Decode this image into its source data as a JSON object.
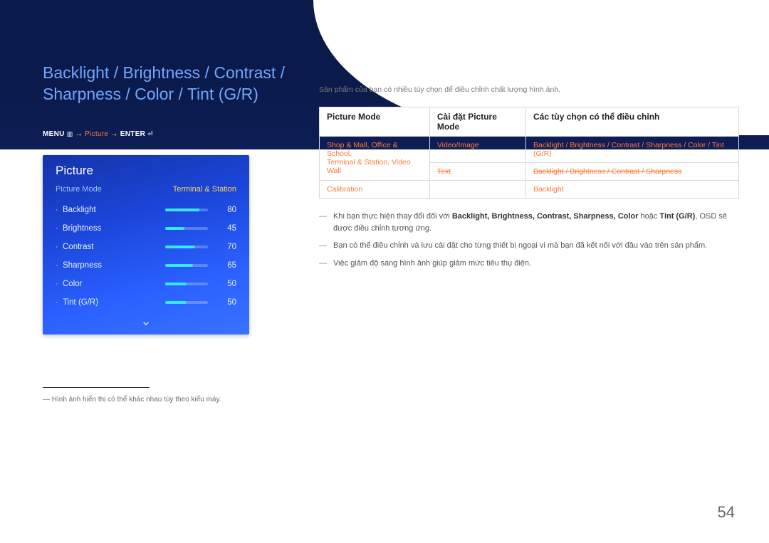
{
  "title": "Backlight / Brightness / Contrast / Sharpness / Color / Tint (G/R)",
  "menu_path": {
    "prefix": "MENU",
    "icon1": "▥",
    "arrow": "→",
    "mid": "Picture",
    "suffix": "ENTER",
    "icon2": "⏎"
  },
  "intro": "Sản phẩm của bạn có nhiều tùy chọn để điều chỉnh chất lượng hình ảnh.",
  "table": {
    "headers": [
      "Picture Mode",
      "Cài đặt Picture Mode",
      "Các tùy chọn có thể điều chỉnh"
    ],
    "rows": [
      {
        "c1_line1a": "Shop & Mall",
        "c1_line1b": "Office & School",
        "c1_line2a": "Terminal & Station",
        "c1_line2b": "Video Wall",
        "c2_r1": "Video/Image",
        "c2_r2": "Text",
        "c3_r1": "Backlight / Brightness / Contrast / Sharpness / Color / Tint (G/R)",
        "c3_r2": "Backlight / Brightness / Contrast / Sharpness"
      },
      {
        "c1": "Calibration",
        "c3": "Backlight"
      }
    ]
  },
  "osd": {
    "title": "Picture",
    "tab_left": "Picture Mode",
    "tab_right": "Terminal & Station",
    "items": [
      {
        "label": "Backlight",
        "value": 80
      },
      {
        "label": "Brightness",
        "value": 45
      },
      {
        "label": "Contrast",
        "value": 70
      },
      {
        "label": "Sharpness",
        "value": 65
      },
      {
        "label": "Color",
        "value": 50
      },
      {
        "label": "Tint (G/R)",
        "value": 50
      }
    ],
    "more": "⌄"
  },
  "footnote": "Hình ảnh hiển thị có thể khác nhau tùy theo kiểu máy.",
  "bullets": {
    "b1_pre": "Khi bạn thực hiện thay đổi đối với ",
    "b1_terms": "Backlight, Brightness, Contrast, Sharpness, Color",
    "b1_mid": " hoặc ",
    "b1_term2": "Tint (G/R)",
    "b1_post": ", OSD sẽ được điều chỉnh tương ứng.",
    "b2": "Bạn có thể điều chỉnh và lưu cài đặt cho từng thiết bị ngoại vi mà bạn đã kết nối với đầu vào trên sản phẩm.",
    "b3": "Việc giảm độ sáng hình ảnh giúp giảm mức tiêu thụ điện."
  },
  "page_number": "54"
}
